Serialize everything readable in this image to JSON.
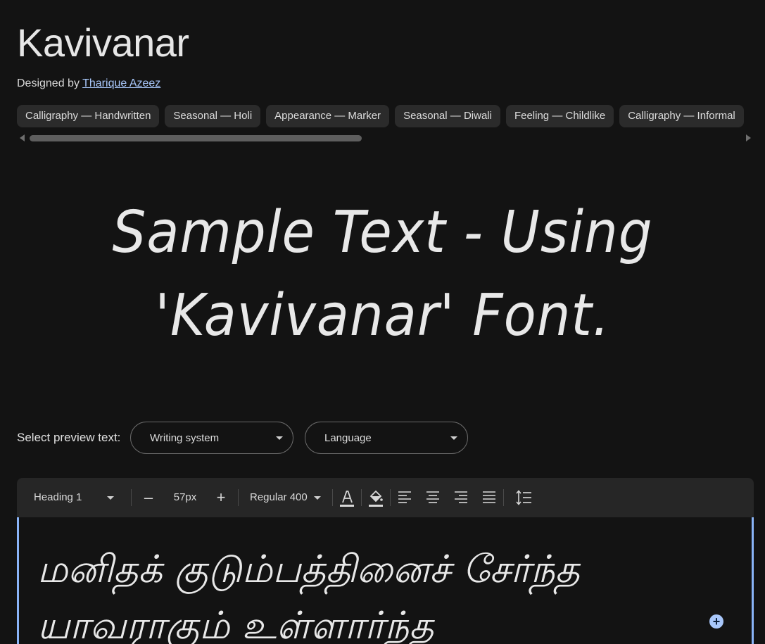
{
  "font": {
    "name": "Kavivanar",
    "designed_by_prefix": "Designed by",
    "designer": "Tharique Azeez"
  },
  "tags": [
    "Calligraphy — Handwritten",
    "Seasonal — Holi",
    "Appearance — Marker",
    "Seasonal — Diwali",
    "Feeling — Childlike",
    "Calligraphy — Informal"
  ],
  "sample": {
    "line1": "Sample Text - Using",
    "line2": "'Kavivanar' Font."
  },
  "preview": {
    "label": "Select preview text:",
    "writing_system": "Writing system",
    "language": "Language"
  },
  "toolbar": {
    "style": "Heading 1",
    "minus": "–",
    "size": "57px",
    "plus": "+",
    "weight": "Regular 400"
  },
  "editor": {
    "text": "மனிதக் குடும்பத்தினைச் சேர்ந்த யாவராகும் உள்ளார்ந்த"
  },
  "colors": {
    "background": "#131313",
    "accent": "#8ab4f8",
    "link": "#a8c7fa"
  }
}
